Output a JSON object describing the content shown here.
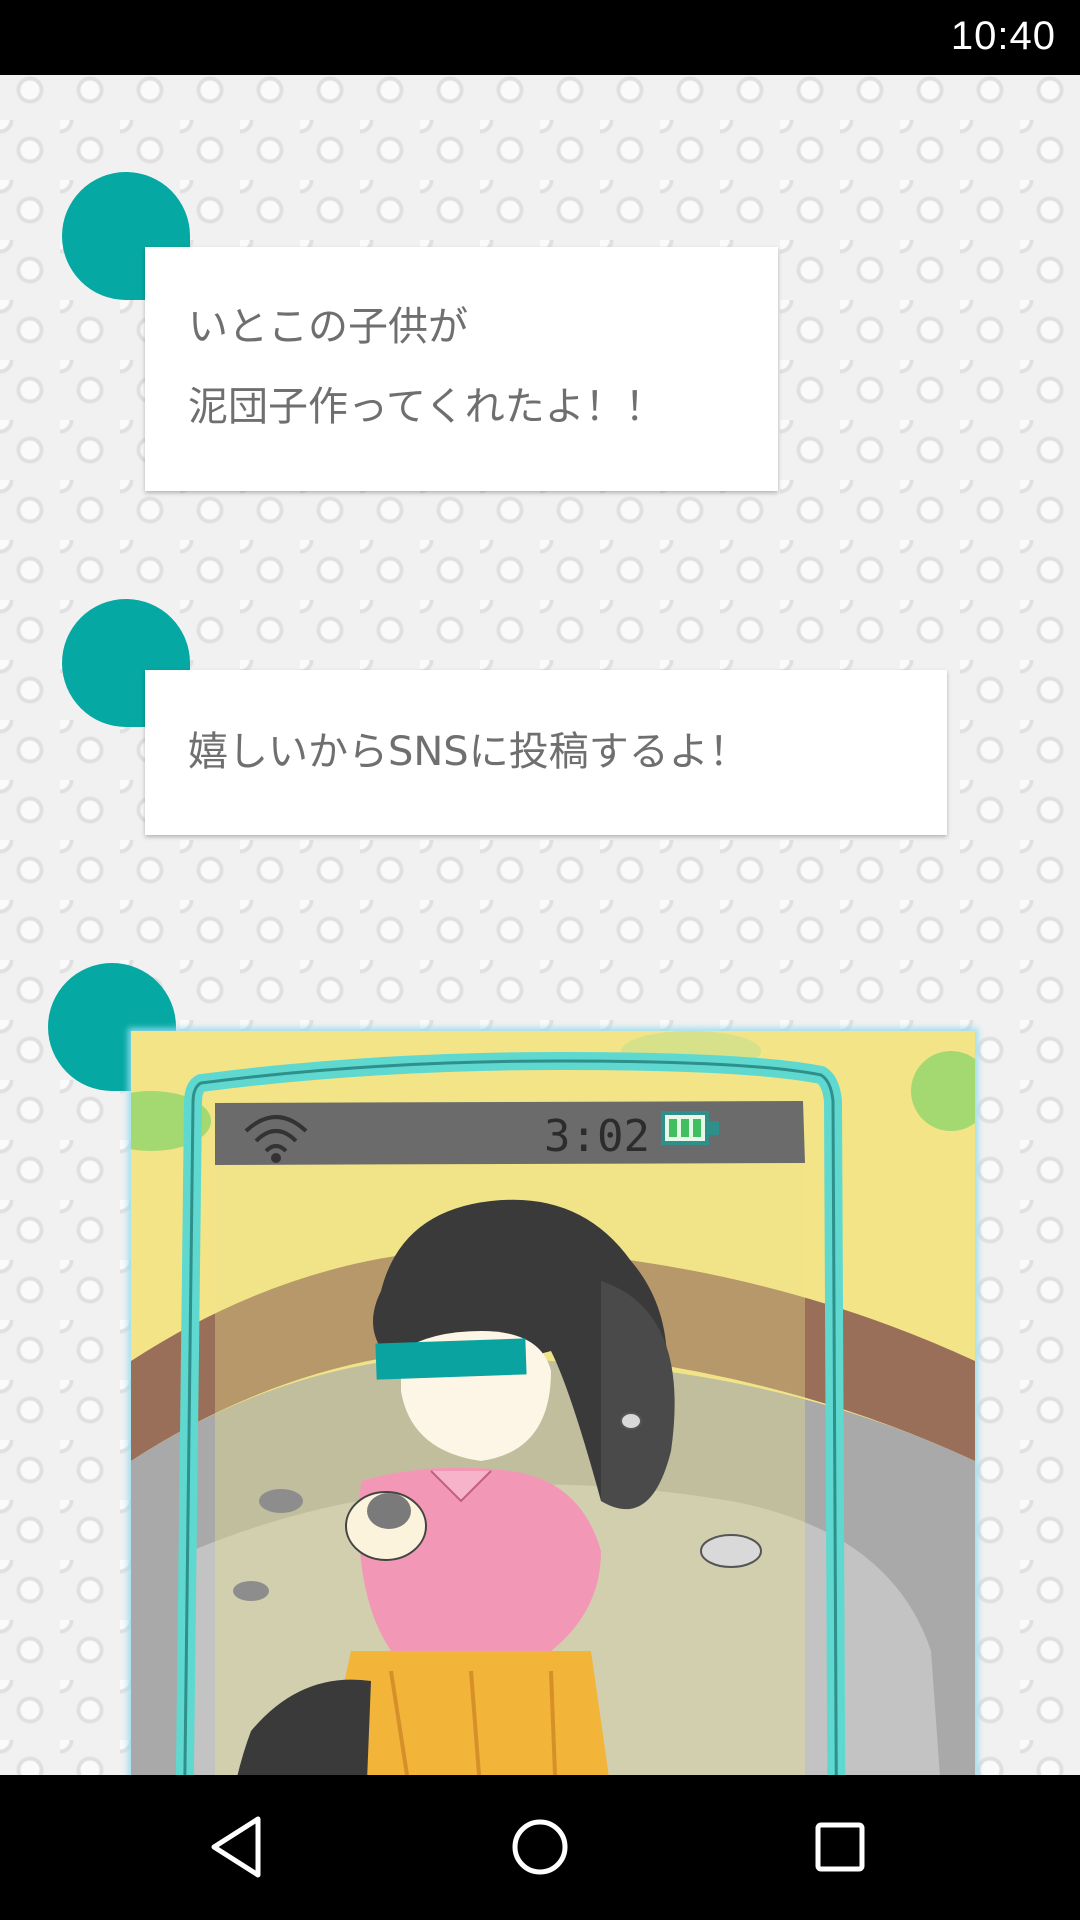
{
  "status_bar": {
    "time": "10:40"
  },
  "messages": [
    {
      "lines": [
        "いとこの子供が",
        "泥団子作ってくれたよ！！"
      ]
    },
    {
      "lines": [
        "嬉しいからSNSに投稿するよ！"
      ]
    }
  ],
  "image_post": {
    "phone_clock": "3:02",
    "icons": [
      "wifi-icon",
      "battery-icon"
    ]
  },
  "nav_bar": {
    "buttons": [
      "back-icon",
      "home-icon",
      "recents-icon"
    ]
  },
  "colors": {
    "accent": "#05a8a2",
    "bubble_text": "#6f6f6f",
    "phone_frame": "#5fd9d0"
  }
}
